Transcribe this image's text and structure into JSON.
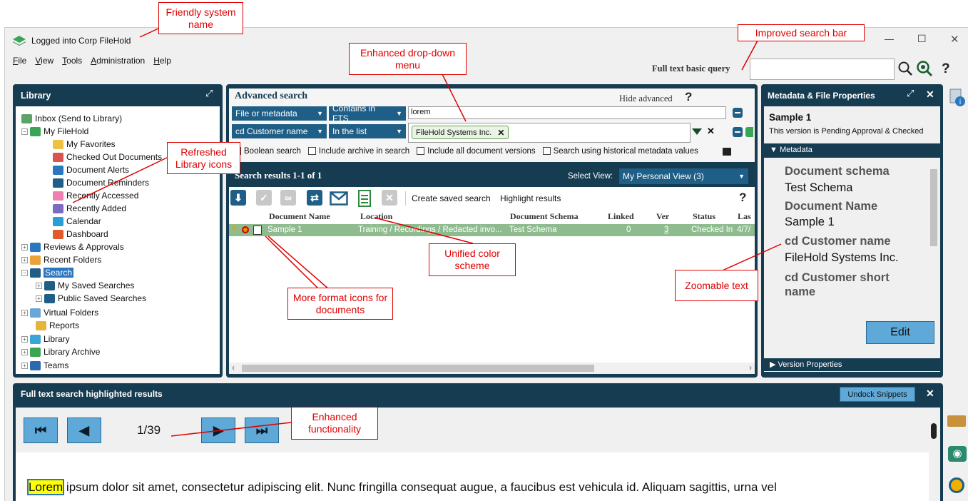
{
  "window": {
    "title": "Logged into Corp FileHold",
    "controls": {
      "min": "—",
      "max": "☐",
      "close": "✕"
    }
  },
  "menu": [
    "File",
    "View",
    "Tools",
    "Administration",
    "Help"
  ],
  "search": {
    "label": "Full text basic query",
    "value": "",
    "help": "?"
  },
  "library": {
    "title": "Library",
    "items": [
      {
        "label": "Inbox (Send to Library)",
        "icon": "inbox-icon"
      },
      {
        "label": "My FileHold",
        "icon": "my-filehold-icon"
      },
      {
        "label": "My Favorites",
        "icon": "star-icon"
      },
      {
        "label": "Checked Out Documents",
        "icon": "checked-out-icon"
      },
      {
        "label": "Document Alerts",
        "icon": "alert-icon"
      },
      {
        "label": "Document Reminders",
        "icon": "reminder-icon"
      },
      {
        "label": "Recently Accessed",
        "icon": "folder-pink-icon"
      },
      {
        "label": "Recently Added",
        "icon": "folder-purple-icon"
      },
      {
        "label": "Calendar",
        "icon": "calendar-icon"
      },
      {
        "label": "Dashboard",
        "icon": "dashboard-icon"
      },
      {
        "label": "Reviews & Approvals",
        "icon": "reviews-icon"
      },
      {
        "label": "Recent Folders",
        "icon": "folder-icon"
      },
      {
        "label": "Search",
        "icon": "search-icon"
      },
      {
        "label": "My Saved Searches",
        "icon": "search-icon"
      },
      {
        "label": "Public Saved Searches",
        "icon": "search-icon"
      },
      {
        "label": "Virtual Folders",
        "icon": "virtual-folder-icon"
      },
      {
        "label": "Reports",
        "icon": "reports-icon"
      },
      {
        "label": "Library",
        "icon": "library-icon"
      },
      {
        "label": "Library Archive",
        "icon": "archive-icon"
      },
      {
        "label": "Teams",
        "icon": "teams-icon"
      }
    ]
  },
  "adv": {
    "title": "Advanced search",
    "hide": "Hide advanced",
    "help": "?",
    "row1": {
      "field": "File or metadata",
      "op": "Contains in FTS",
      "value": "lorem"
    },
    "row2": {
      "field": "cd Customer name",
      "op": "In the list",
      "chip": "FileHold Systems Inc."
    },
    "options": [
      "Boolean search",
      "Include archive in search",
      "Include all document versions",
      "Search using historical metadata values"
    ],
    "results_title": "Search results 1-1 of 1",
    "select_view_label": "Select View:",
    "select_view_value": "My Personal View (3)",
    "create_saved": "Create saved search",
    "highlight": "Highlight results",
    "help2": "?",
    "columns": [
      "Document Name",
      "Location",
      "Document Schema",
      "Linked",
      "Ver",
      "Status",
      "Las"
    ],
    "row": [
      "Sample 1",
      "Training / Recordings / Redacted invo...",
      "Test Schema",
      "0",
      "3",
      "Checked In",
      "4/7/"
    ]
  },
  "meta": {
    "title": "Metadata & File Properties",
    "doc": "Sample 1",
    "status": "This version is Pending Approval & Checked",
    "section": "Metadata",
    "fields": [
      {
        "k": "Document schema",
        "v": "Test Schema"
      },
      {
        "k": "Document Name",
        "v": "Sample 1"
      },
      {
        "k": "cd Customer name",
        "v": "FileHold Systems Inc."
      },
      {
        "k": "cd Customer short name",
        "v": ""
      }
    ],
    "edit": "Edit",
    "version": "Version Properties"
  },
  "fts": {
    "title": "Full text search highlighted results",
    "undock": "Undock Snippets",
    "page": "1/39",
    "highlight_word": "Lorem",
    "text": " ipsum dolor sit amet, consectetur adipiscing elit. Nunc fringilla consequat augue, a faucibus est vehicula id. Aliquam sagittis, urna vel"
  },
  "annotations": {
    "friendly": "Friendly system name",
    "search": "Improved search bar",
    "dropdown": "Enhanced drop-down menu",
    "icons": "Refreshed Library icons",
    "color": "Unified color scheme",
    "format": "More format icons for documents",
    "zoom": "Zoomable text",
    "func": "Enhanced functionality"
  },
  "colors": {
    "navy": "#163c52",
    "accent": "#1f5e86",
    "row": "#8fbc8f",
    "annot": "#e00000",
    "button": "#5ea9d8"
  }
}
